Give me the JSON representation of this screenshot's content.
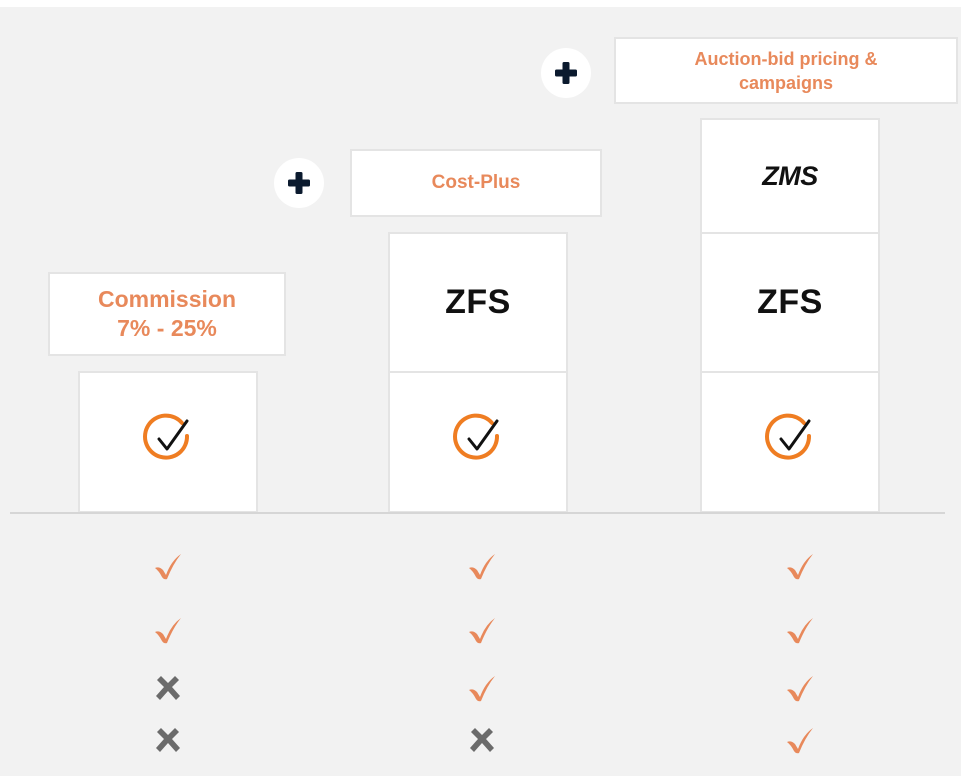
{
  "colors": {
    "accent": "#e8895b",
    "ring": "#ef7d22",
    "cross": "#6b6b6b",
    "plus": "#0b1a2e",
    "background": "#f2f2f2"
  },
  "columns": [
    {
      "pricing_label": "Commission\n7% - 25%",
      "has_plus_icon": false,
      "tiles": [
        "check-circle-icon"
      ]
    },
    {
      "pricing_label": "Cost-Plus",
      "has_plus_icon": true,
      "tiles": [
        "ZFS",
        "check-circle-icon"
      ]
    },
    {
      "pricing_label": "Auction-bid pricing &\ncampaigns",
      "has_plus_icon": true,
      "tiles": [
        "ZMS",
        "ZFS",
        "check-circle-icon"
      ]
    }
  ],
  "tiles": {
    "zfs_1": "ZFS",
    "zfs_2": "ZFS",
    "zms": "ZMS"
  },
  "labels": {
    "commission": "Commission\n7% - 25%",
    "cost_plus": "Cost-Plus",
    "auction": "Auction-bid pricing &\ncampaigns"
  },
  "feature_matrix": [
    [
      "check",
      "check",
      "check"
    ],
    [
      "check",
      "check",
      "check"
    ],
    [
      "cross",
      "check",
      "check"
    ],
    [
      "cross",
      "cross",
      "check"
    ]
  ]
}
